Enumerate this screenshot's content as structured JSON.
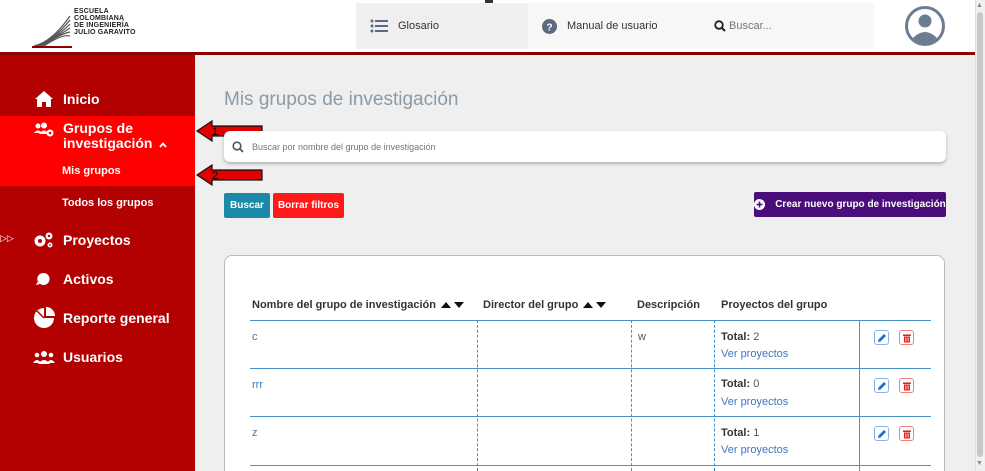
{
  "header": {
    "logo_lines": [
      "ESCUELA",
      "COLOMBIANA",
      "DE INGENIERÍA",
      "JULIO GARAVITO"
    ],
    "glosario": "Glosario",
    "manual": "Manual de usuario",
    "search_placeholder": "Buscar..."
  },
  "sidebar": {
    "inicio": "Inicio",
    "grupos_line1": "Grupos de",
    "grupos_line2": "investigación",
    "mis_grupos": "Mis grupos",
    "todos_grupos": "Todos los grupos",
    "proyectos": "Proyectos",
    "activos": "Activos",
    "reporte": "Reporte general",
    "usuarios": "Usuarios"
  },
  "annotations": {
    "arrow1": "1",
    "arrow2": "2"
  },
  "main": {
    "title": "Mis grupos de investigación",
    "search_placeholder": "Buscar por nombre del grupo de investigación",
    "buscar": "Buscar",
    "borrar": "Borrar filtros",
    "crear": "Crear nuevo grupo de investigación"
  },
  "table": {
    "headers": [
      "Nombre del grupo de investigación",
      "Director del grupo",
      "Descripción",
      "Proyectos del grupo"
    ],
    "total_label": "Total:",
    "ver_label": "Ver proyectos",
    "rows": [
      {
        "nombre": "c",
        "director": "",
        "descripcion": "w",
        "total": "2"
      },
      {
        "nombre": "rrr",
        "director": "",
        "descripcion": "",
        "total": "0"
      },
      {
        "nombre": "z",
        "director": "",
        "descripcion": "",
        "total": "1"
      }
    ]
  },
  "colors": {
    "sidebar": "#b30000",
    "sidebar_active": "#ff0000",
    "buscar": "#1a8aa8",
    "borrar": "#ff1a1a",
    "crear": "#4a0d7a",
    "link": "#3a78c2"
  }
}
